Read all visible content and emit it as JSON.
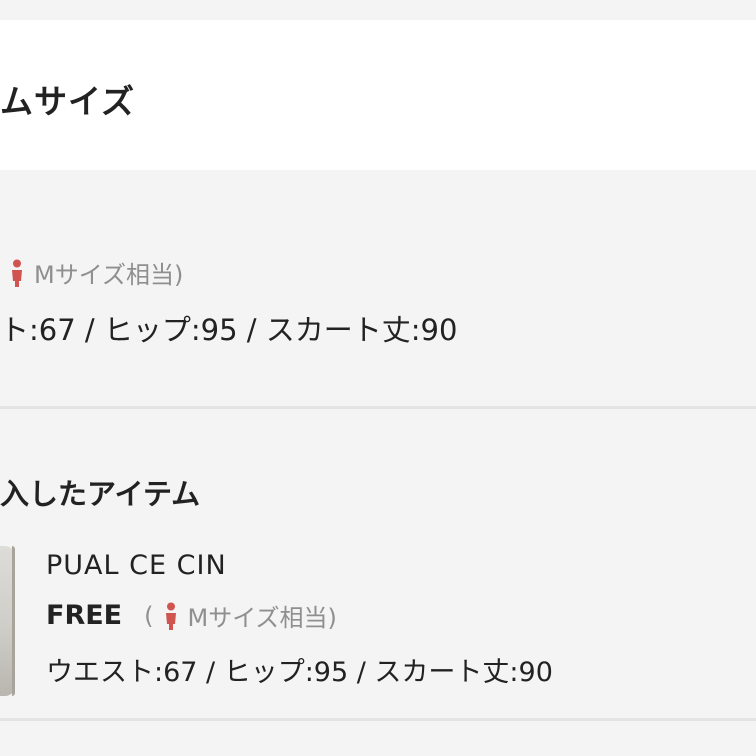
{
  "header": {
    "title": "ムサイズ"
  },
  "size_info": {
    "equivalent": "Mサイズ相当)",
    "measurements": "ト:67 / ヒップ:95 / スカート丈:90"
  },
  "purchased": {
    "title": "入したアイテム",
    "item": {
      "brand": "PUAL CE CIN",
      "size": "FREE",
      "open_paren": "(",
      "equivalent": "Mサイズ相当)",
      "measurements": "ウエスト:67 / ヒップ:95 / スカート丈:90"
    }
  },
  "icons": {
    "person": "person-icon",
    "color": "#d0544f"
  },
  "colors": {
    "muted_text": "#8f8f8f",
    "body_text": "#222222",
    "panel_background": "#f4f4f4",
    "card_background": "#ffffff"
  }
}
